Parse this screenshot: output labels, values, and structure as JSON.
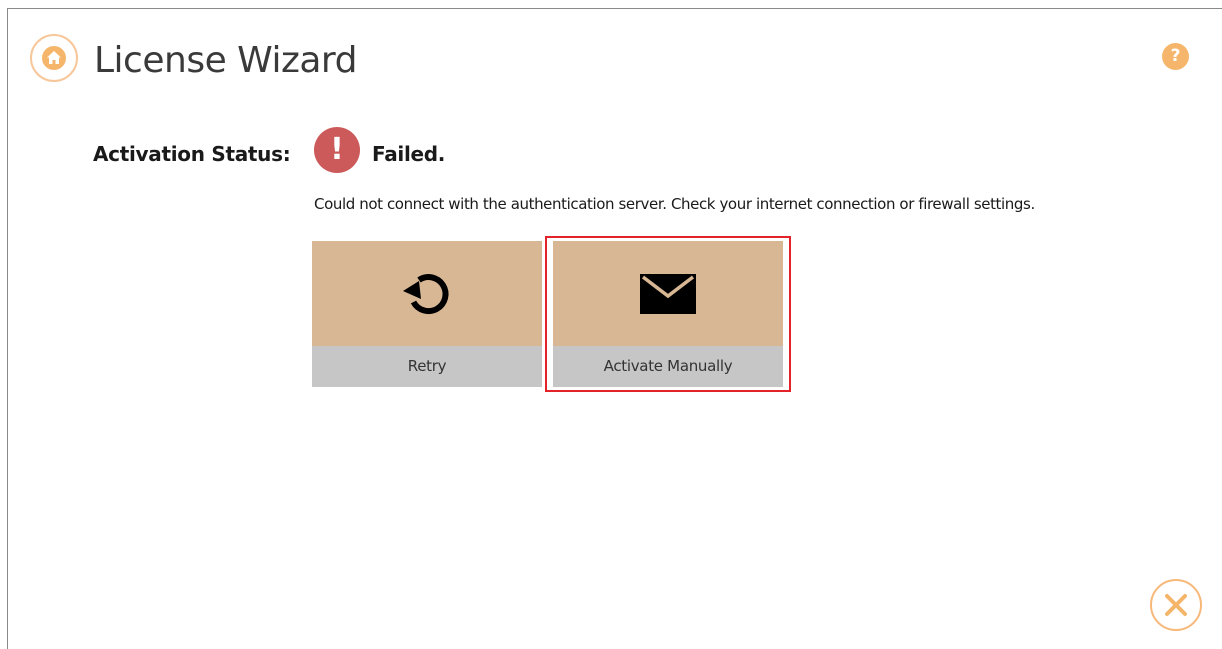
{
  "header": {
    "title": "License Wizard",
    "home_icon": "home-icon",
    "help_icon": "help-icon",
    "help_glyph": "?"
  },
  "status": {
    "label": "Activation Status:",
    "value": "Failed.",
    "icon": "error-icon",
    "icon_glyph": "!",
    "message": "Could not connect with the authentication server. Check your internet connection or firewall settings."
  },
  "actions": {
    "retry_label": "Retry",
    "retry_icon": "refresh-icon",
    "manual_label": "Activate Manually",
    "manual_icon": "envelope-icon"
  },
  "footer": {
    "close_icon": "close-icon"
  },
  "colors": {
    "accent_orange": "#f5b66b",
    "tile_top": "#d8b794",
    "tile_bottom": "#c6c6c6",
    "error_red": "#cc5a5a",
    "highlight_red": "#e3222a"
  }
}
